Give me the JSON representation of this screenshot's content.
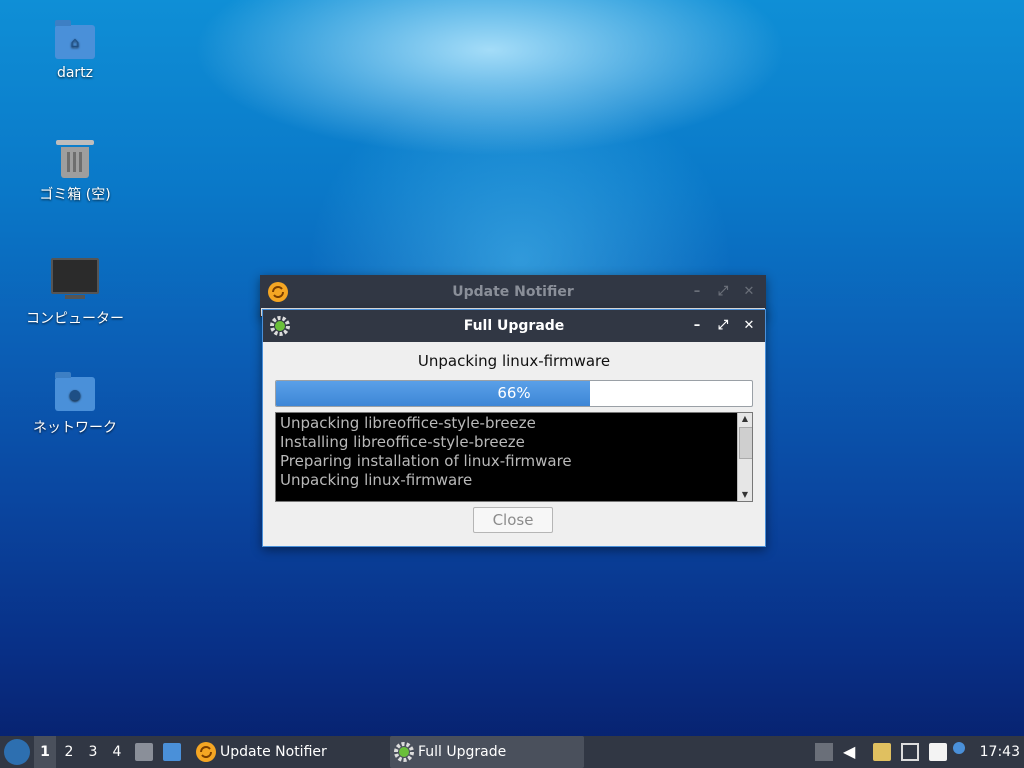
{
  "desktop": {
    "icons": [
      {
        "label": "dartz",
        "icon": "home-folder-icon"
      },
      {
        "label": "ゴミ箱 (空)",
        "icon": "trash-icon"
      },
      {
        "label": "コンピューター",
        "icon": "computer-icon"
      },
      {
        "label": "ネットワーク",
        "icon": "network-folder-icon"
      }
    ]
  },
  "update_notifier": {
    "title": "Update Notifier",
    "controls": [
      "–",
      "⤢",
      "✕"
    ]
  },
  "full_upgrade": {
    "title": "Full Upgrade",
    "controls": [
      "–",
      "⤢",
      "✕"
    ],
    "status": "Unpacking linux-firmware",
    "progress": {
      "value": 0.66,
      "label": "66%"
    },
    "log": [
      "Unpacking libreoffice-style-breeze",
      "Installing libreoffice-style-breeze",
      "Preparing installation of linux-firmware",
      "Unpacking linux-firmware"
    ],
    "close_label": "Close"
  },
  "taskbar": {
    "workspaces": [
      "1",
      "2",
      "3",
      "4"
    ],
    "active_workspace": "1",
    "tasks": [
      {
        "label": "Update Notifier",
        "icon": "update-notifier-icon",
        "active": false
      },
      {
        "label": "Full Upgrade",
        "icon": "gear-icon",
        "active": true
      }
    ],
    "clock": "17:43"
  },
  "colors": {
    "accent": "#4a90d9",
    "titlebar": "#313744",
    "progress_fill": "#3d86d6"
  }
}
